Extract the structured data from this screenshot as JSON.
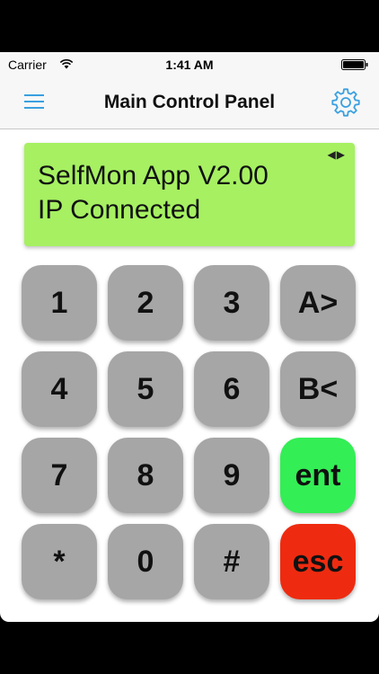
{
  "status_bar": {
    "carrier": "Carrier",
    "time": "1:41 AM"
  },
  "nav": {
    "title": "Main Control Panel",
    "left_icon": "menu-icon",
    "right_icon": "gear-icon",
    "accent_color": "#3aa0e0"
  },
  "display": {
    "line1": "SelfMon App V2.00",
    "line2": "IP Connected",
    "arrows": "◀▶",
    "background_color": "#a6f062"
  },
  "keypad": {
    "row1": [
      "1",
      "2",
      "3",
      "A>"
    ],
    "row2": [
      "4",
      "5",
      "6",
      "B<"
    ],
    "row3": [
      "7",
      "8",
      "9",
      "ent"
    ],
    "row4": [
      "*",
      "0",
      "#",
      "esc"
    ],
    "colors": {
      "default": "#a6a6a6",
      "enter": "#33ee55",
      "escape": "#ee2b10"
    }
  }
}
